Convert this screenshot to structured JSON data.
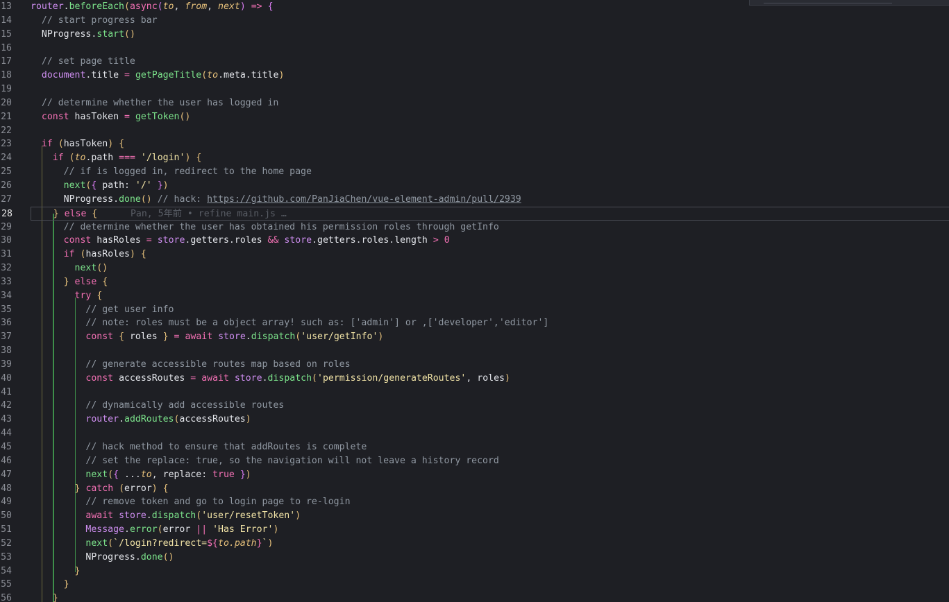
{
  "editor": {
    "active_line": "28",
    "blame_annotation": "Pan, 5年前 • refine main.js …",
    "lines": [
      {
        "n": "13",
        "t": "router.beforeEach(async(to, from, next) => {"
      },
      {
        "n": "14",
        "t": "  // start progress bar"
      },
      {
        "n": "15",
        "t": "  NProgress.start()"
      },
      {
        "n": "16",
        "t": ""
      },
      {
        "n": "17",
        "t": "  // set page title"
      },
      {
        "n": "18",
        "t": "  document.title = getPageTitle(to.meta.title)"
      },
      {
        "n": "19",
        "t": ""
      },
      {
        "n": "20",
        "t": "  // determine whether the user has logged in"
      },
      {
        "n": "21",
        "t": "  const hasToken = getToken()"
      },
      {
        "n": "22",
        "t": ""
      },
      {
        "n": "23",
        "t": "  if (hasToken) {"
      },
      {
        "n": "24",
        "t": "    if (to.path === '/login') {"
      },
      {
        "n": "25",
        "t": "      // if is logged in, redirect to the home page"
      },
      {
        "n": "26",
        "t": "      next({ path: '/' })"
      },
      {
        "n": "27",
        "t": "      NProgress.done() // hack: https://github.com/PanJiaChen/vue-element-admin/pull/2939"
      },
      {
        "n": "28",
        "t": "    } else {"
      },
      {
        "n": "29",
        "t": "      // determine whether the user has obtained his permission roles through getInfo"
      },
      {
        "n": "30",
        "t": "      const hasRoles = store.getters.roles && store.getters.roles.length > 0"
      },
      {
        "n": "31",
        "t": "      if (hasRoles) {"
      },
      {
        "n": "32",
        "t": "        next()"
      },
      {
        "n": "33",
        "t": "      } else {"
      },
      {
        "n": "34",
        "t": "        try {"
      },
      {
        "n": "35",
        "t": "          // get user info"
      },
      {
        "n": "36",
        "t": "          // note: roles must be a object array! such as: ['admin'] or ,['developer','editor']"
      },
      {
        "n": "37",
        "t": "          const { roles } = await store.dispatch('user/getInfo')"
      },
      {
        "n": "38",
        "t": ""
      },
      {
        "n": "39",
        "t": "          // generate accessible routes map based on roles"
      },
      {
        "n": "40",
        "t": "          const accessRoutes = await store.dispatch('permission/generateRoutes', roles)"
      },
      {
        "n": "41",
        "t": ""
      },
      {
        "n": "42",
        "t": "          // dynamically add accessible routes"
      },
      {
        "n": "43",
        "t": "          router.addRoutes(accessRoutes)"
      },
      {
        "n": "44",
        "t": ""
      },
      {
        "n": "45",
        "t": "          // hack method to ensure that addRoutes is complete"
      },
      {
        "n": "46",
        "t": "          // set the replace: true, so the navigation will not leave a history record"
      },
      {
        "n": "47",
        "t": "          next({ ...to, replace: true })"
      },
      {
        "n": "48",
        "t": "        } catch (error) {"
      },
      {
        "n": "49",
        "t": "          // remove token and go to login page to re-login"
      },
      {
        "n": "50",
        "t": "          await store.dispatch('user/resetToken')"
      },
      {
        "n": "51",
        "t": "          Message.error(error || 'Has Error')"
      },
      {
        "n": "52",
        "t": "          next(`/login?redirect=${to.path}`)"
      },
      {
        "n": "53",
        "t": "          NProgress.done()"
      },
      {
        "n": "54",
        "t": "        }"
      },
      {
        "n": "55",
        "t": "      }"
      },
      {
        "n": "56",
        "t": "    }"
      }
    ]
  }
}
